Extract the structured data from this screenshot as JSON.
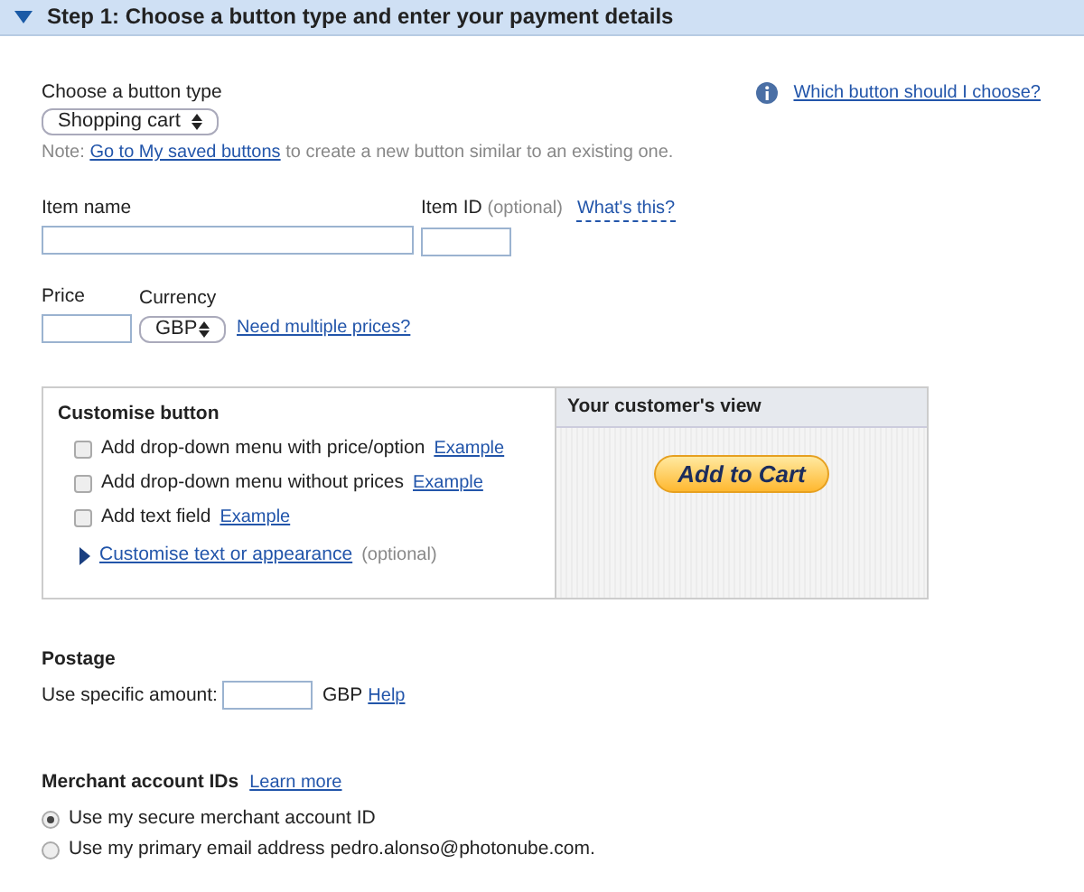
{
  "header": {
    "title": "Step 1: Choose a button type and enter your payment details",
    "expanded": true
  },
  "button_type": {
    "label": "Choose a button type",
    "value": "Shopping cart",
    "help_link": "Which button should I choose?"
  },
  "note": {
    "prefix": "Note:",
    "link": "Go to My saved buttons",
    "suffix": "to create a new button similar to an existing one."
  },
  "item_name": {
    "label": "Item name"
  },
  "item_id": {
    "label": "Item ID",
    "hint": "(optional)",
    "link": "What's this?"
  },
  "price": {
    "label": "Price"
  },
  "currency": {
    "label": "Currency",
    "value": "GBP",
    "link": "Need multiple prices?"
  },
  "customise": {
    "title": "Customise button",
    "options": [
      {
        "label": "Add drop-down menu with price/option",
        "link": "Example",
        "checked": false
      },
      {
        "label": "Add drop-down menu without prices",
        "link": "Example",
        "checked": false
      },
      {
        "label": "Add text field",
        "link": "Example",
        "checked": false
      }
    ],
    "more": {
      "link": "Customise text or appearance",
      "hint": "(optional)",
      "expanded": false
    }
  },
  "preview": {
    "title": "Your customer's view",
    "button": "Add to Cart"
  },
  "postage": {
    "title": "Postage",
    "label": "Use specific amount:",
    "unit": "GBP",
    "link": "Help"
  },
  "merchant": {
    "title": "Merchant account IDs",
    "link": "Learn more",
    "options": [
      {
        "label": "Use my secure merchant account ID",
        "selected": true
      },
      {
        "label": "Use my primary email address pedro.alonso@photonube.com.",
        "selected": false
      }
    ]
  }
}
